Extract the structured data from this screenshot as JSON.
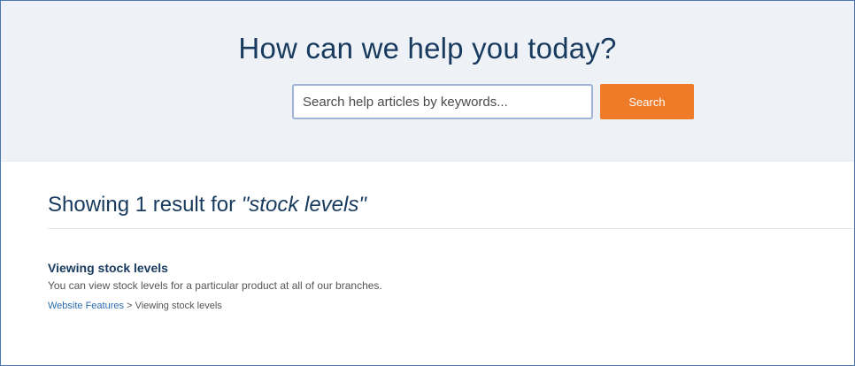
{
  "hero": {
    "title": "How can we help you today?",
    "search_placeholder": "Search help articles by keywords...",
    "search_button_label": "Search"
  },
  "results": {
    "heading_prefix": "Showing 1 result for ",
    "query": "\"stock levels\"",
    "items": [
      {
        "title": "Viewing stock levels",
        "description": "You can view stock levels for a particular product at all of our branches.",
        "breadcrumb_link": "Website Features",
        "breadcrumb_separator": " > ",
        "breadcrumb_current": "Viewing stock levels"
      }
    ]
  },
  "colors": {
    "brand_navy": "#173a5e",
    "accent_orange": "#ef7a28",
    "hero_background": "#eef1f6",
    "link_blue": "#2b6cb0"
  }
}
